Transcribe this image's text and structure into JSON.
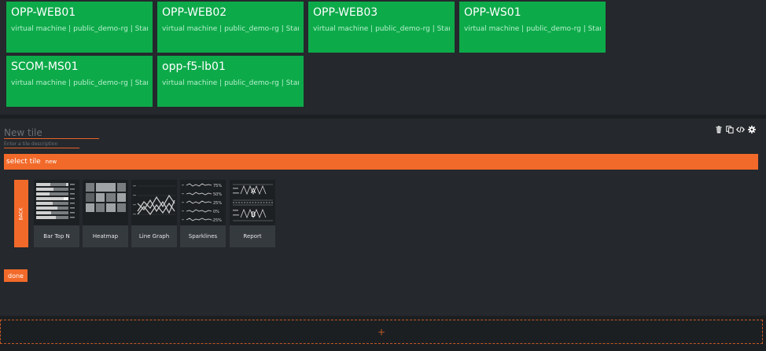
{
  "vm_tiles": [
    {
      "name": "OPP-WEB01",
      "subtitle": "virtual machine | public_demo-rg | Stan..."
    },
    {
      "name": "OPP-WEB02",
      "subtitle": "virtual machine | public_demo-rg | Stan..."
    },
    {
      "name": "OPP-WEB03",
      "subtitle": "virtual machine | public_demo-rg | Stan..."
    },
    {
      "name": "OPP-WS01",
      "subtitle": "virtual machine | public_demo-rg | Stan..."
    },
    {
      "name": "SCOM-MS01",
      "subtitle": "virtual machine | public_demo-rg | Stan..."
    },
    {
      "name": "opp-f5-lb01",
      "subtitle": "virtual machine | public_demo-rg | Stan..."
    }
  ],
  "editor": {
    "title_placeholder": "New tile",
    "description_placeholder": "Enter a tile description",
    "select_label": "select tile",
    "select_value": "new",
    "back_label": "BACK",
    "done_label": "done",
    "toolbar_icons": [
      "trash-icon",
      "copy-icon",
      "code-icon",
      "gear-icon"
    ],
    "tile_types": [
      {
        "label": "Bar Top N",
        "icon": "bar-top-n-thumbnail"
      },
      {
        "label": "Heatmap",
        "icon": "heatmap-thumbnail"
      },
      {
        "label": "Line Graph",
        "icon": "line-graph-thumbnail"
      },
      {
        "label": "Sparklines",
        "icon": "sparklines-thumbnail"
      },
      {
        "label": "Report",
        "icon": "report-thumbnail"
      }
    ],
    "sparkline_values": [
      "75%",
      "50%",
      "25%",
      "0%",
      "-25%"
    ],
    "report_letters": [
      "A",
      "B"
    ]
  },
  "add_row_label": "+",
  "colors": {
    "tile_green": "#0daa4a",
    "accent_orange": "#f26a2a",
    "panel_bg": "#25282c",
    "page_bg": "#1c1f22"
  }
}
